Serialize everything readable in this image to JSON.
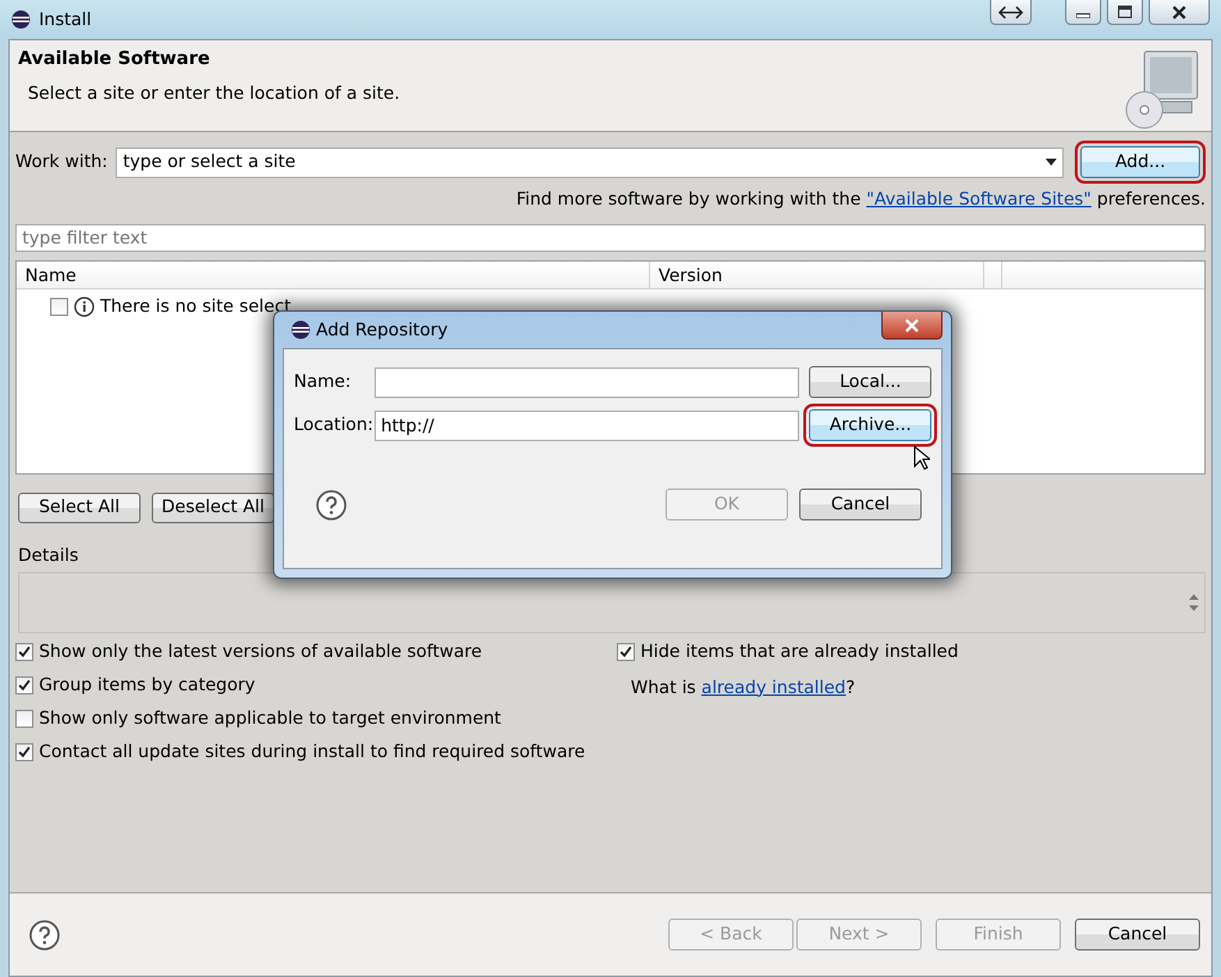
{
  "window": {
    "title": "Install"
  },
  "header": {
    "title": "Available Software",
    "subtitle": "Select a site or enter the location of a site."
  },
  "work_with": {
    "label": "Work with:",
    "value": "type or select a site",
    "add_button": {
      "label": "Add...",
      "highlighted": true
    }
  },
  "find_more": {
    "before": "Find more software by working with the ",
    "link": "\"Available Software Sites\"",
    "after": " preferences."
  },
  "filter": {
    "placeholder": "type filter text"
  },
  "table": {
    "columns": [
      "Name",
      "Version"
    ],
    "rows": [
      {
        "text": "There is no site select",
        "checked": false
      }
    ]
  },
  "table_buttons": [
    {
      "label": "Select All"
    },
    {
      "label": "Deselect All"
    }
  ],
  "details": {
    "label": "Details"
  },
  "options_left": [
    {
      "label": "Show only the latest versions of available software",
      "checked": true
    },
    {
      "label": "Group items by category",
      "checked": true
    },
    {
      "label": "Show only software applicable to target environment",
      "checked": false
    },
    {
      "label": "Contact all update sites during install to find required software",
      "checked": true
    }
  ],
  "options_right": [
    {
      "label": "Hide items that are already installed",
      "checked": true
    }
  ],
  "installed_note": {
    "before": "What is ",
    "link": "already installed",
    "after": "?"
  },
  "footer_buttons": [
    {
      "label": "< Back",
      "disabled": true
    },
    {
      "label": "Next >",
      "disabled": true
    },
    {
      "label": "Finish",
      "disabled": true
    },
    {
      "label": "Cancel",
      "disabled": false
    }
  ],
  "dialog": {
    "title": "Add Repository",
    "fields": [
      {
        "label": "Name:",
        "button": {
          "label": "Local...",
          "highlighted": false
        }
      },
      {
        "label": "Location:",
        "value": "http://",
        "button": {
          "label": "Archive...",
          "highlighted": true
        }
      }
    ],
    "buttons": [
      {
        "label": "OK",
        "disabled": true
      },
      {
        "label": "Cancel",
        "disabled": false
      }
    ]
  }
}
